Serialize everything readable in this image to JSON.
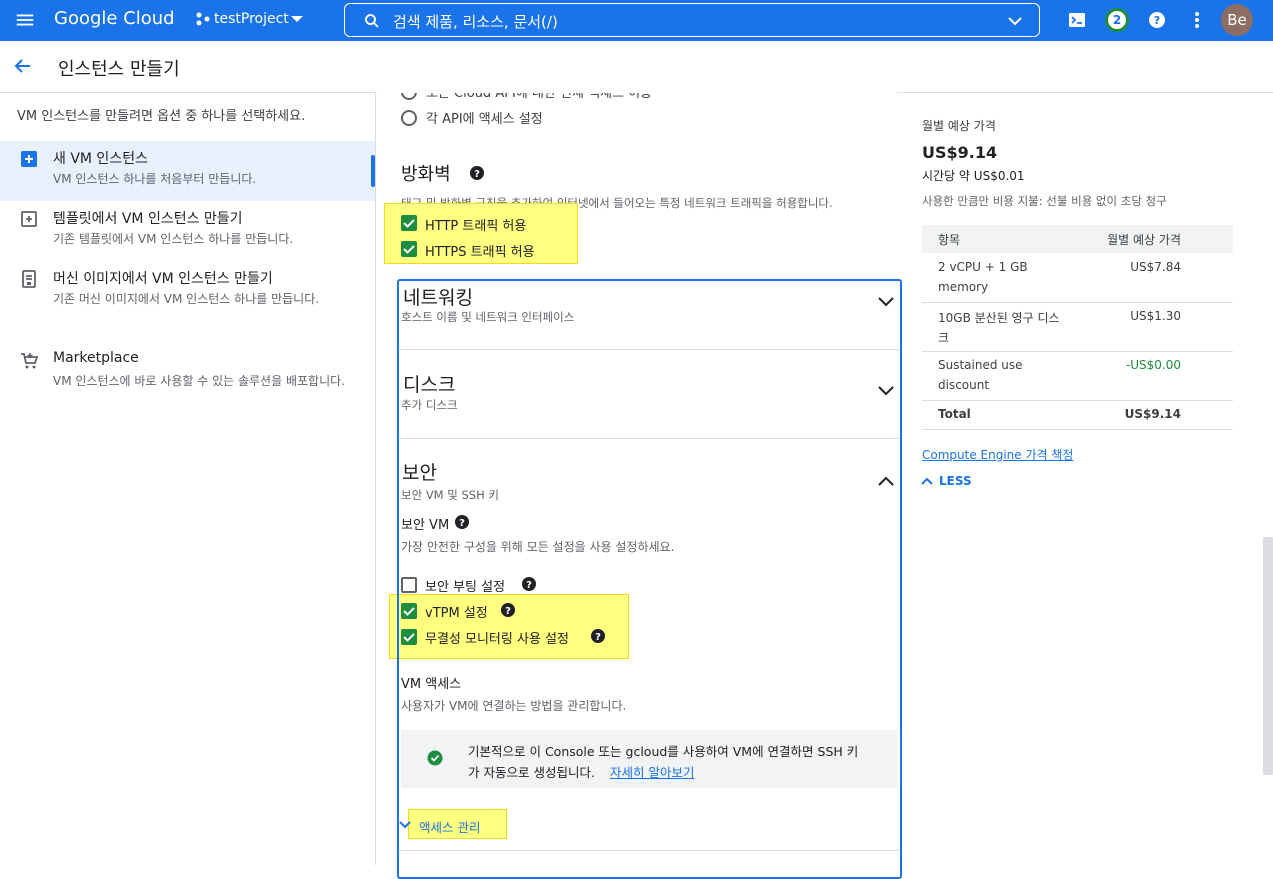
{
  "topbar": {
    "logo": "Google Cloud",
    "project": "testProject",
    "search_placeholder": "검색   제품, 리소스, 문서(/)",
    "notifications_count": "2",
    "avatar_initials": "Be"
  },
  "header": {
    "title": "인스턴스 만들기"
  },
  "leftnav": {
    "intro": "VM 인스턴스를 만들려면 옵션 중 하나를 선택하세요.",
    "items": [
      {
        "title": "새 VM 인스턴스",
        "desc": "VM 인스턴스 하나를 처음부터 만듭니다."
      },
      {
        "title": "템플릿에서 VM 인스턴스 만들기",
        "desc": "기존 템플릿에서 VM 인스턴스 하나를 만듭니다."
      },
      {
        "title": "머신 이미지에서 VM 인스턴스 만들기",
        "desc": "기존 머신 이미지에서 VM 인스턴스 하나를 만듭니다."
      },
      {
        "title": "Marketplace",
        "desc": "VM 인스턴스에 바로 사용할 수 있는 솔루션을 배포합니다."
      }
    ]
  },
  "main": {
    "api_option_partial": "모든 Cloud API에 대한 전체 액세스 허용",
    "api_option_each": "각 API에 액세스 설정",
    "firewall": {
      "title": "방화벽",
      "desc": "태그 및 방화벽 규칙을 추가하여 인터넷에서 들어오는 특정 네트워크 트래픽을 허용합니다.",
      "http": "HTTP 트래픽 허용",
      "https": "HTTPS 트래픽 허용"
    },
    "networking": {
      "title": "네트워킹",
      "desc": "호스트 이름 및 네트워크 인터페이스"
    },
    "disk": {
      "title": "디스크",
      "desc": "추가 디스크"
    },
    "security": {
      "title": "보안",
      "desc": "보안 VM 및 SSH 키",
      "shielded_title": "보안 VM",
      "shielded_desc": "가장 안전한 구성을 위해 모든 설정을 사용 설정하세요.",
      "secure_boot": "보안 부팅 설정",
      "vtpm": "vTPM 설정",
      "integrity": "무결성 모니터링 사용 설정",
      "vm_access_title": "VM 액세스",
      "vm_access_desc": "사용자가 VM에 연결하는 방법을 관리합니다.",
      "notice_line1": "기본적으로 이 Console 또는 gcloud를 사용하여 VM에 연결하면 SSH 키",
      "notice_line2": "가 자동으로 생성됩니다.",
      "learn_more": "자세히 알아보기",
      "manage_access": "액세스 관리"
    },
    "checked": {
      "http": true,
      "https": true,
      "secure_boot": false,
      "vtpm": true,
      "integrity": true
    }
  },
  "pricing": {
    "label": "월별 예상 가격",
    "total": "US$9.14",
    "hourly": "시간당 약 US$0.01",
    "note": "사용한 만큼만 비용 지불: 선불 비용 없이 초당 청구",
    "col_item": "항목",
    "col_price": "월별 예상 가격",
    "rows": [
      {
        "item_l1": "2 vCPU + 1 GB",
        "item_l2": "memory",
        "price": "US$7.84"
      },
      {
        "item_l1": "10GB 분산된 영구 디스",
        "item_l2": "크",
        "price": "US$1.30"
      },
      {
        "item_l1": "Sustained use",
        "item_l2": "discount",
        "price": "-US$0.00"
      },
      {
        "item_l1": "Total",
        "item_l2": "",
        "price": "US$9.14"
      }
    ],
    "link": "Compute Engine 가격 책정",
    "less": "LESS"
  },
  "colors": {
    "accent": "#1a73e8",
    "check": "#1e8e3e",
    "highlight": "#ffff80"
  }
}
